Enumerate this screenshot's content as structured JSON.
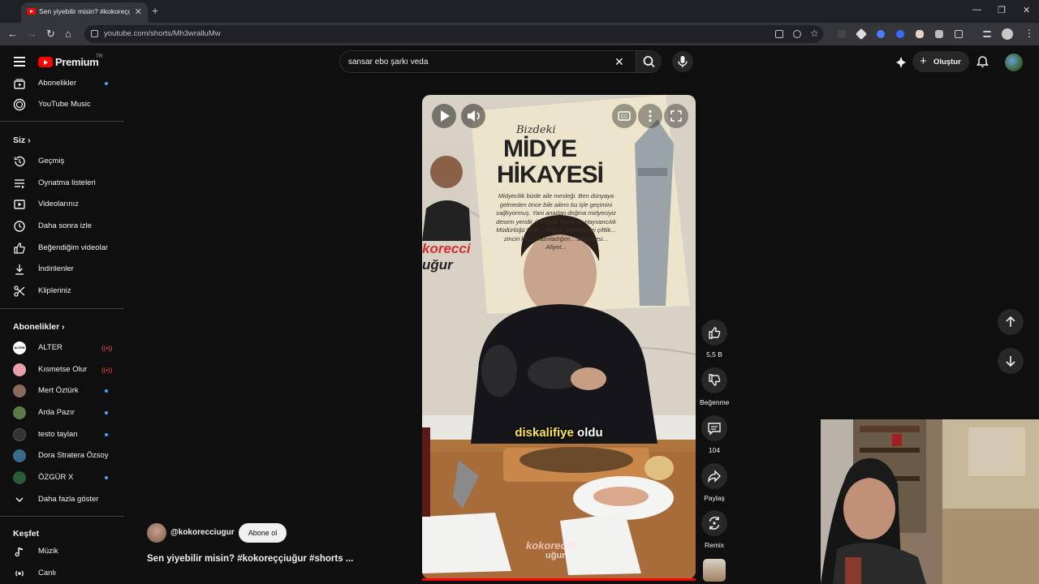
{
  "browser": {
    "tab_title": "Sen yiyebilir misin? #kokoreççiuğ",
    "url": "youtube.com/shorts/Mh3wralluMw"
  },
  "header": {
    "logo_text": "Premium",
    "region": "TR",
    "search_query": "sansar ebo şarkı veda",
    "create_label": "Oluştur"
  },
  "sidebar": {
    "top_items": [
      {
        "label": "Abonelikler",
        "icon": "subscriptions-icon",
        "dot": true
      },
      {
        "label": "YouTube Music",
        "icon": "youtube-music-icon"
      }
    ],
    "you_heading": "Siz",
    "you_items": [
      {
        "label": "Geçmiş",
        "icon": "history-icon"
      },
      {
        "label": "Oynatma listeleri",
        "icon": "playlist-icon"
      },
      {
        "label": "Videolarınız",
        "icon": "your-videos-icon"
      },
      {
        "label": "Daha sonra izle",
        "icon": "watch-later-icon"
      },
      {
        "label": "Beğendiğim videolar",
        "icon": "liked-videos-icon"
      },
      {
        "label": "İndirilenler",
        "icon": "download-icon"
      },
      {
        "label": "Klipleriniz",
        "icon": "scissors-icon"
      }
    ],
    "subs_heading": "Abonelikler",
    "subscriptions": [
      {
        "name": "ALTER",
        "status": "live",
        "avatar_color": "#ffffff"
      },
      {
        "name": "Kısmetse Olur",
        "status": "live",
        "avatar_color": "#e8a0b0"
      },
      {
        "name": "Mert Öztürk",
        "status": "dot",
        "avatar_color": "#8a6a5a"
      },
      {
        "name": "Arda Pazır",
        "status": "dot",
        "avatar_color": "#5a7a4a"
      },
      {
        "name": "testo taylan",
        "status": "dot",
        "avatar_color": "#333333"
      },
      {
        "name": "Dora Stratera Özsoy",
        "status": "none",
        "avatar_color": "#3a6a8a"
      },
      {
        "name": "ÖZGÜR X",
        "status": "dot",
        "avatar_color": "#2a5a3a"
      }
    ],
    "show_more": "Daha fazla göster",
    "explore_heading": "Keşfet",
    "explore_items": [
      {
        "label": "Müzik",
        "icon": "music-note-icon"
      },
      {
        "label": "Canlı",
        "icon": "live-icon"
      }
    ]
  },
  "short": {
    "poster_heading_small": "Bizdeki",
    "poster_heading_1": "MİDYE",
    "poster_heading_2": "HİKAYESİ",
    "poster_body": "Midyecilik bizde aile mesleği. Ben dünyaya gelmeden önce bile ailem bu işle geçimini sağlıyormuş. Yani anadan doğma midyeciyiz desem yeridir :) İl Gıda Tarım ve Hayvancılık Müdürlüğü taraf... Soğuk ürünlerimizi çiftlik... zinciri kırı... hazırladığım... tüketmesi... Afiyet...",
    "poster_brand_1": "korecci",
    "poster_brand_2": "uğur",
    "caption_highlight": "diskalifiye",
    "caption_rest": " oldu",
    "watermark_1": "kokorecci",
    "watermark_2": "uğur",
    "channel": "@kokorecciugur",
    "subscribe_label": "Abone ol",
    "title": "Sen yiyebilir misin? #kokoreççiuğur #shorts ...",
    "likes": "5,5 B",
    "dislike_label": "Beğenme",
    "comments": "104",
    "share_label": "Paylaş",
    "remix_label": "Remix"
  },
  "colors": {
    "accent_red": "#ff0000",
    "dot_blue": "#3ea6ff",
    "caption_yellow": "#ffe44d"
  }
}
